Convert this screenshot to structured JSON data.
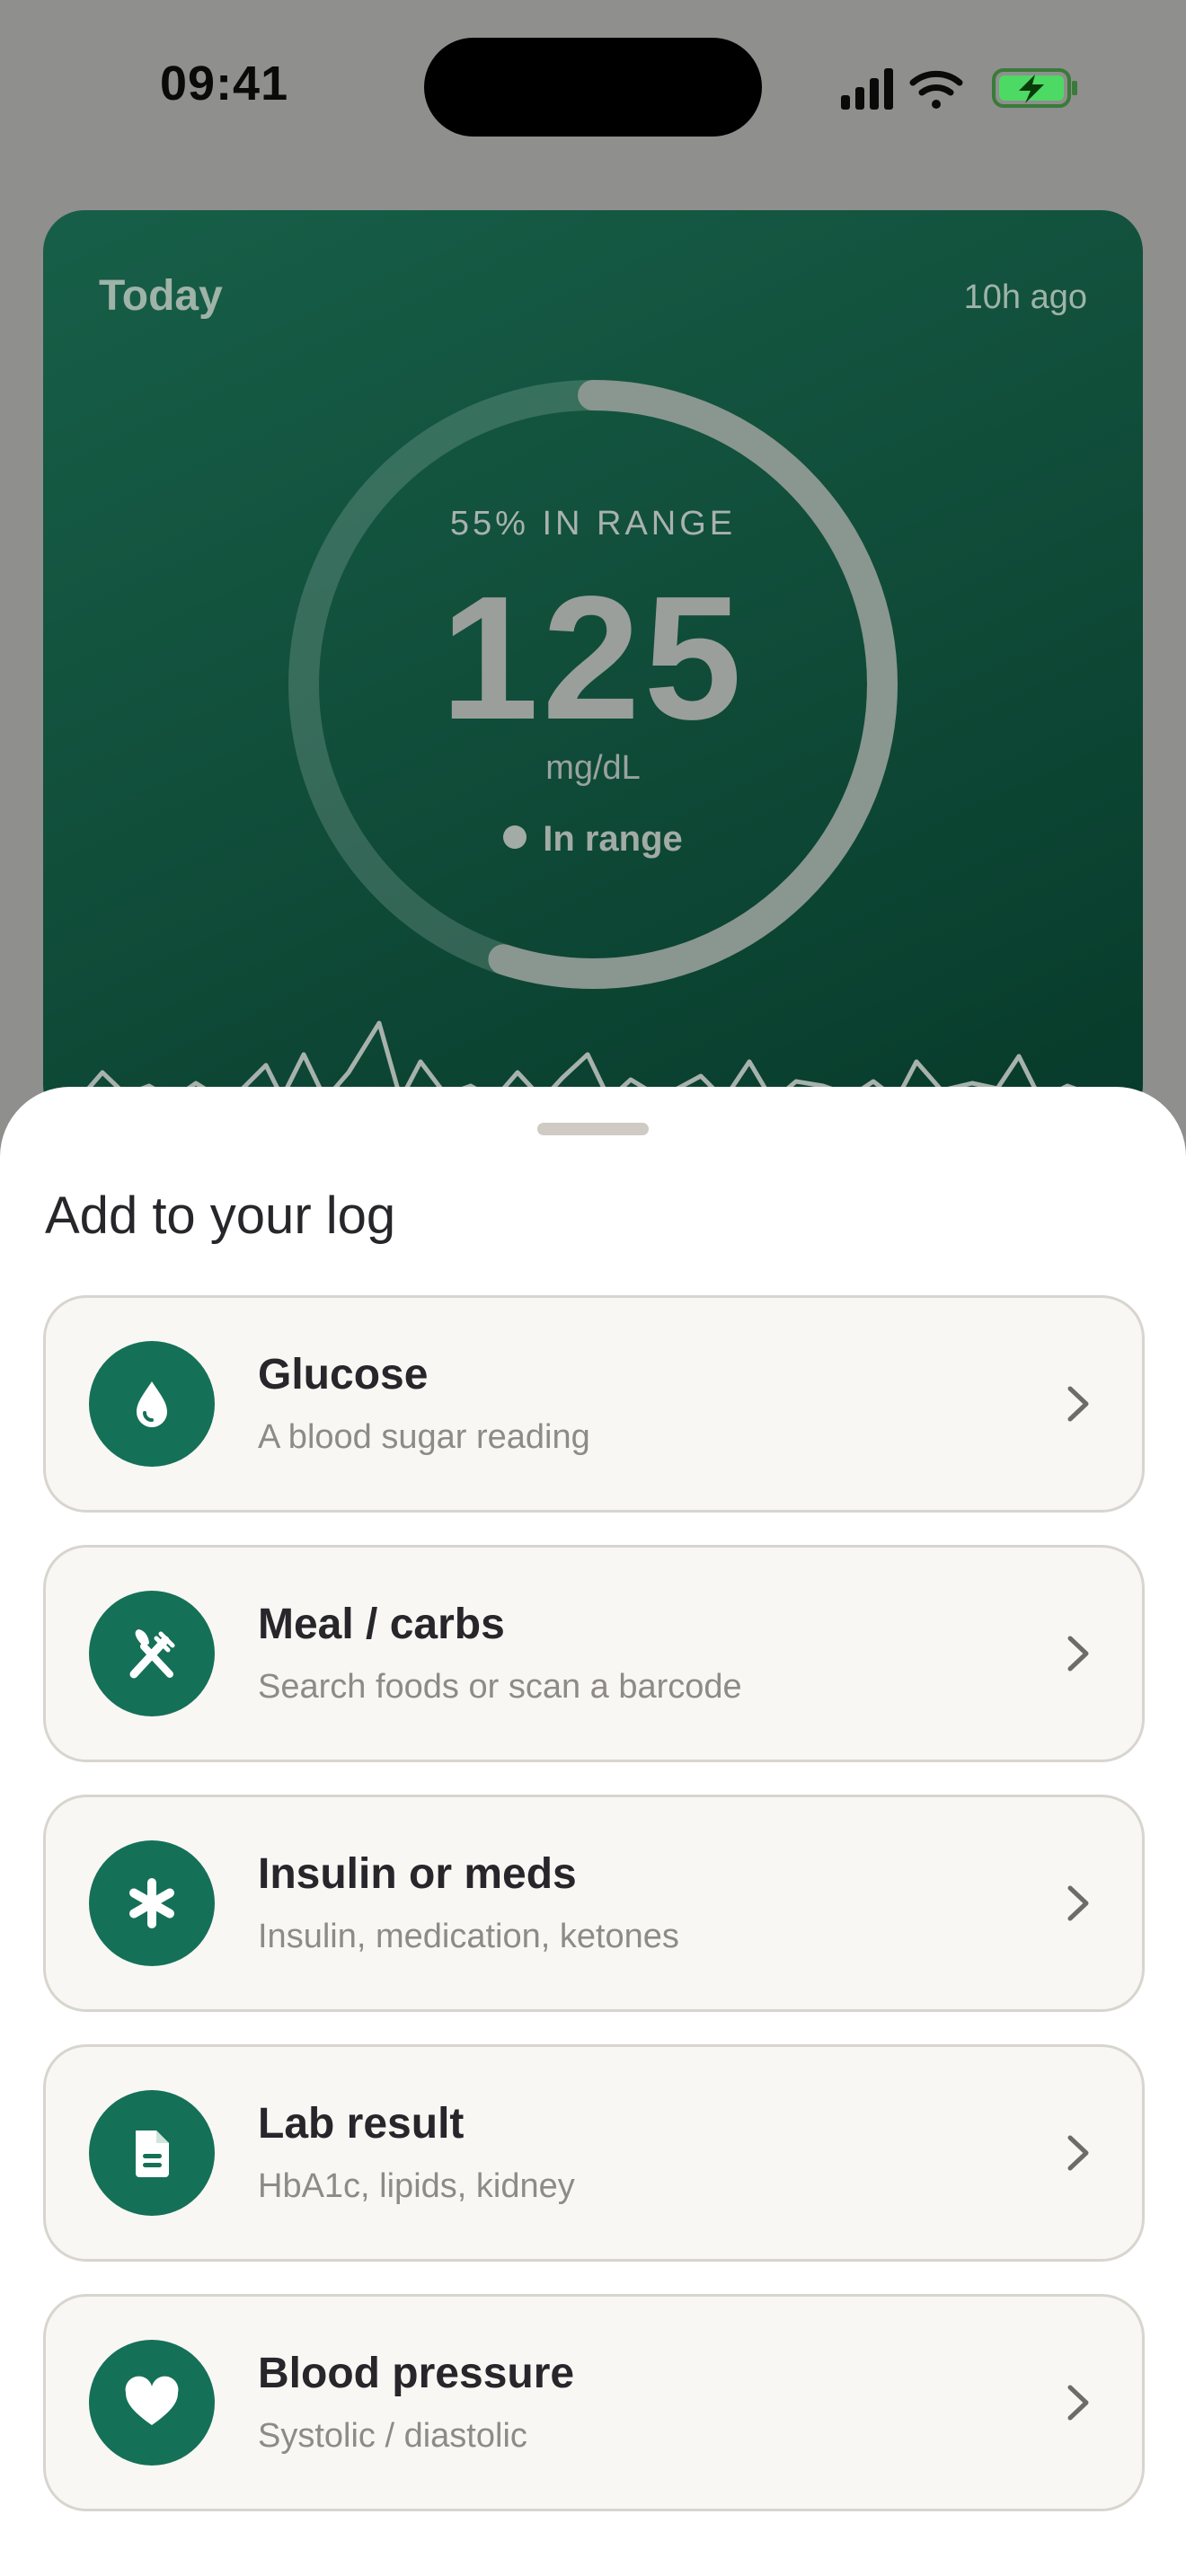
{
  "status_bar": {
    "time": "09:41",
    "icons": [
      "signal-icon",
      "wifi-icon",
      "battery-charging-icon"
    ],
    "battery_color": "#4cd964"
  },
  "today_card": {
    "title": "Today",
    "updated": "10h ago",
    "in_range_label": "55% IN RANGE",
    "in_range_fraction": 0.55,
    "value": "125",
    "unit": "mg/dL",
    "status": "In range",
    "accent_color": "#175f48"
  },
  "sheet": {
    "title": "Add to your log",
    "items": [
      {
        "label": "Glucose",
        "subtitle": "A blood sugar reading",
        "icon": "drop-icon"
      },
      {
        "label": "Meal / carbs",
        "subtitle": "Search foods or scan a barcode",
        "icon": "fork-knife-icon"
      },
      {
        "label": "Insulin or meds",
        "subtitle": "Insulin, medication, ketones",
        "icon": "asterisk-icon"
      },
      {
        "label": "Lab result",
        "subtitle": "HbA1c, lipids, kidney",
        "icon": "document-icon"
      },
      {
        "label": "Blood pressure",
        "subtitle": "Systolic / diastolic",
        "icon": "heart-icon"
      }
    ],
    "icon_background": "#157058"
  }
}
